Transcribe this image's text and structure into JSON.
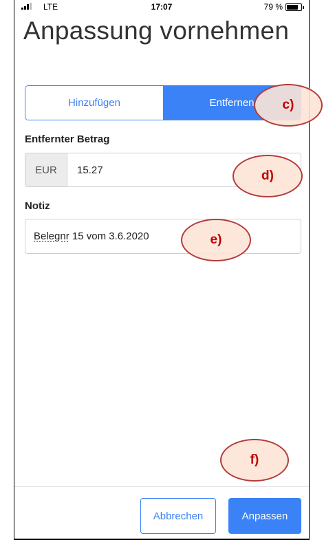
{
  "status_bar": {
    "carrier": "LTE",
    "time": "17:07",
    "battery_pct": "79 %",
    "battery_level": 0.79
  },
  "page": {
    "title": "Anpassung vornehmen"
  },
  "segmented": {
    "add_label": "Hinzufügen",
    "remove_label": "Entfernen",
    "selected": "Entfernen"
  },
  "amount": {
    "label": "Entfernter Betrag",
    "currency": "EUR",
    "value": "15.27"
  },
  "note": {
    "label": "Notiz",
    "value_word": "Belegnr",
    "value_rest": " 15 vom 3.6.2020"
  },
  "buttons": {
    "cancel": "Abbrechen",
    "apply": "Anpassen"
  },
  "annotations": {
    "c": "c)",
    "d": "d)",
    "e": "e)",
    "f": "f)"
  },
  "colors": {
    "accent": "#3b82f6",
    "callout_fill": "#fce4d6",
    "callout_border": "#b43b3b",
    "callout_text": "#c00000"
  }
}
